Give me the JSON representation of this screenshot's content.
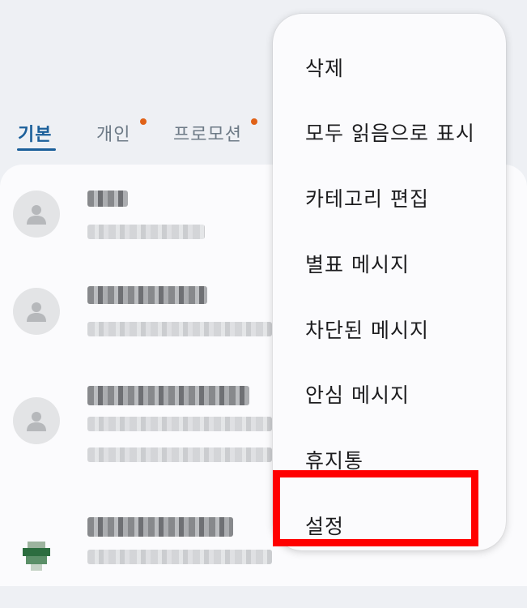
{
  "tabs": [
    {
      "label": "기본",
      "active": true,
      "has_dot": false
    },
    {
      "label": "개인",
      "active": false,
      "has_dot": true
    },
    {
      "label": "프로모션",
      "active": false,
      "has_dot": true
    }
  ],
  "colors": {
    "active_tab": "#1b5f9a",
    "inactive_tab": "#6d7a86",
    "notification_dot": "#e06218",
    "highlight_box": "#ff0000",
    "menu_background": "#fbfbfd"
  },
  "menu": {
    "items": [
      {
        "label": "삭제"
      },
      {
        "label": "모두 읽음으로 표시"
      },
      {
        "label": "카테고리 편집"
      },
      {
        "label": "별표 메시지"
      },
      {
        "label": "차단된 메시지"
      },
      {
        "label": "안심 메시지"
      },
      {
        "label": "휴지통"
      },
      {
        "label": "설정",
        "highlighted": true
      }
    ]
  },
  "conversations": [
    {
      "avatar": "person-icon"
    },
    {
      "avatar": "person-icon"
    },
    {
      "avatar": "person-icon"
    },
    {
      "avatar": "profile-image"
    }
  ]
}
